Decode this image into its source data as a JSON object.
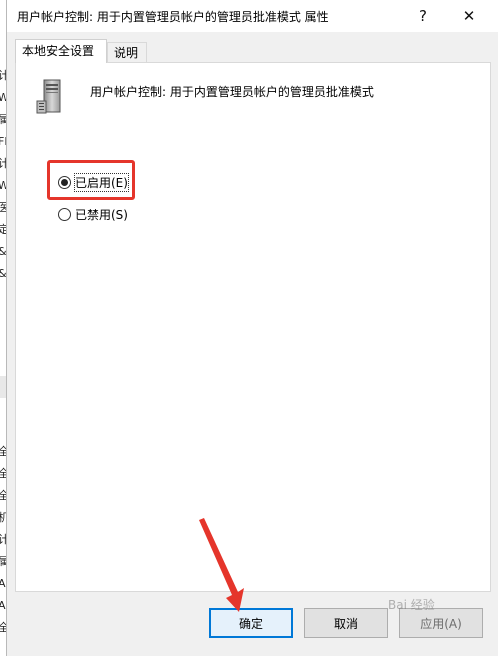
{
  "window": {
    "title": "用户帐户控制: 用于内置管理员帐户的管理员批准模式 属性",
    "help_glyph": "?",
    "close_glyph": "✕"
  },
  "tabs": [
    {
      "label": "本地安全设置",
      "active": true
    },
    {
      "label": "说明",
      "active": false
    }
  ],
  "policy": {
    "icon": "server-icon",
    "description": "用户帐户控制: 用于内置管理员帐户的管理员批准模式"
  },
  "options": [
    {
      "label": "已启用(E)",
      "selected": true
    },
    {
      "label": "已禁用(S)",
      "selected": false
    }
  ],
  "buttons": {
    "ok": "确定",
    "cancel": "取消",
    "apply": "应用(A)"
  },
  "background_chars": [
    "计",
    "W",
    "属",
    "FI",
    "计",
    "W",
    "医",
    "定",
    "&",
    "&",
    "全",
    "全",
    "全",
    "机",
    "计",
    "属",
    "A",
    "A",
    "全"
  ],
  "watermark": "Bai 经验",
  "colors": {
    "highlight": "#e5352b",
    "focus_border": "#0078d7"
  }
}
